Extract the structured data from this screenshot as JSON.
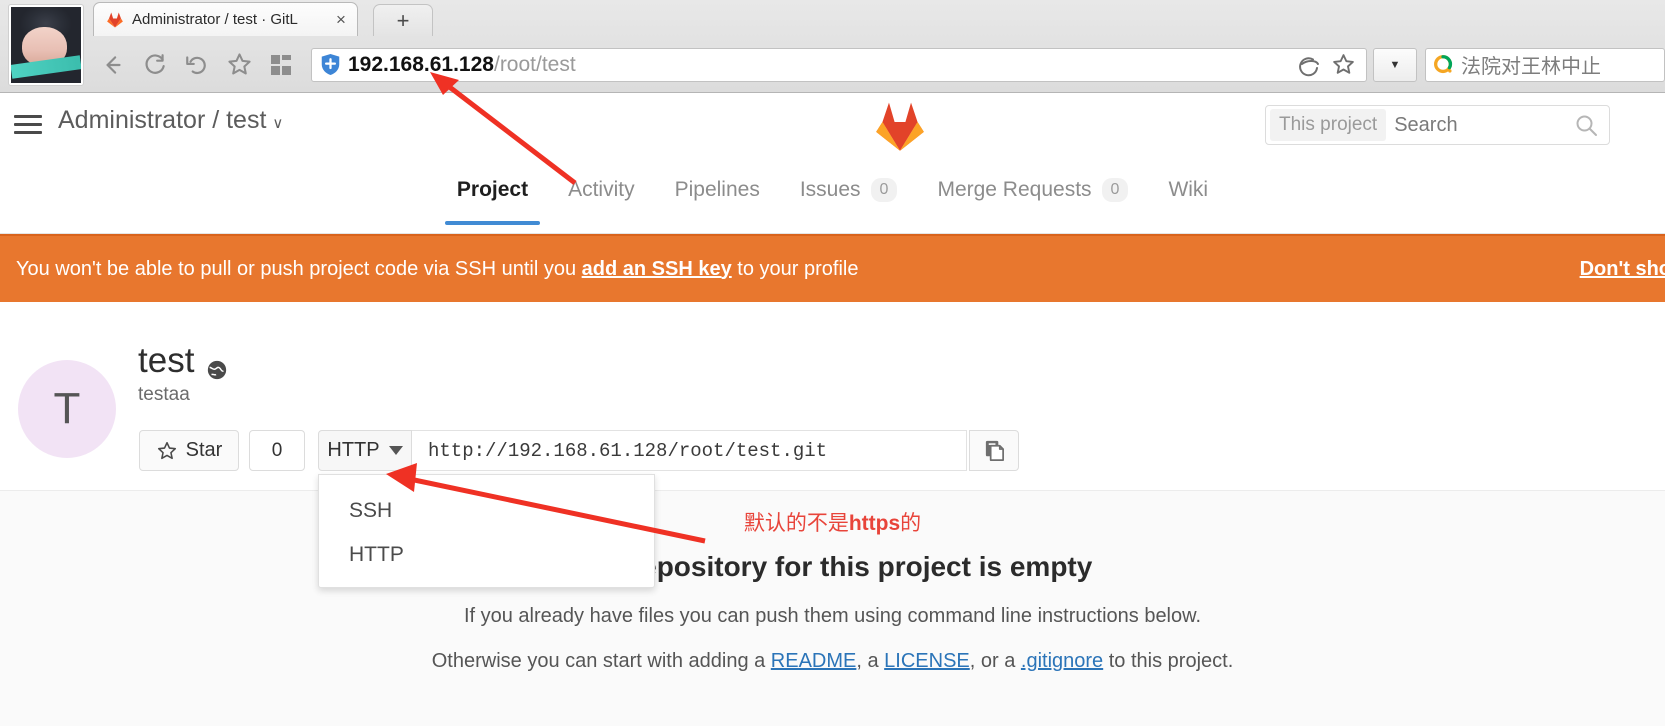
{
  "browser": {
    "tab_title": "Administrator / test · GitL",
    "tab_close": "×",
    "new_tab": "+",
    "back_icon": "←",
    "reload_icon": "⟳",
    "forward_history_icon": "↺",
    "bookmark_icon": "☆",
    "apps_icon": "grid",
    "url_host": "192.168.61.128",
    "url_path": "/root/test",
    "ie_icon": "e",
    "star_icon": "☆",
    "dropdown_caret": "▼",
    "search_engine_text": "法院对王林中止"
  },
  "gitlab_header": {
    "breadcrumb": "Administrator / test",
    "breadcrumb_caret": "∨",
    "search_scope": "This project",
    "search_placeholder": "Search"
  },
  "nav_tabs": [
    {
      "label": "Project",
      "count": "",
      "active": true
    },
    {
      "label": "Activity",
      "count": "",
      "active": false
    },
    {
      "label": "Pipelines",
      "count": "",
      "active": false
    },
    {
      "label": "Issues",
      "count": "0",
      "active": false
    },
    {
      "label": "Merge Requests",
      "count": "0",
      "active": false
    },
    {
      "label": "Wiki",
      "count": "",
      "active": false
    }
  ],
  "alert": {
    "prefix": "You won't be able to pull or push project code via SSH until you ",
    "link": "add an SSH key",
    "suffix": " to your profile",
    "dismiss": "Don't sho",
    "bg_color": "#e8772e"
  },
  "project": {
    "avatar_letter": "T",
    "name": "test",
    "visibility_icon": "globe-icon",
    "description": "testaa",
    "star_label": "Star",
    "star_count": "0",
    "clone_protocol": "HTTP",
    "clone_url": "http://192.168.61.128/root/test.git",
    "copy_icon": "copy-icon"
  },
  "protocol_menu": {
    "items": [
      "SSH",
      "HTTP"
    ]
  },
  "empty_repo": {
    "annotation_cn": "默认的不是",
    "annotation_cn_bold": "https",
    "annotation_cn_tail": "的",
    "title": "The repository for this project is empty",
    "line1": "If you already have files you can push them using command line instructions below.",
    "line2_pre": "Otherwise you can start with adding a ",
    "line2_readme": "README",
    "line2_mid1": ", a ",
    "line2_license": "LICENSE",
    "line2_mid2": ", or a ",
    "line2_gitignore": ".gitignore",
    "line2_post": " to this project."
  },
  "colors": {
    "accent_blue": "#418bd4",
    "alert_orange": "#e8772e",
    "annotation_red": "#e8443a",
    "link_blue": "#2b74b8"
  }
}
